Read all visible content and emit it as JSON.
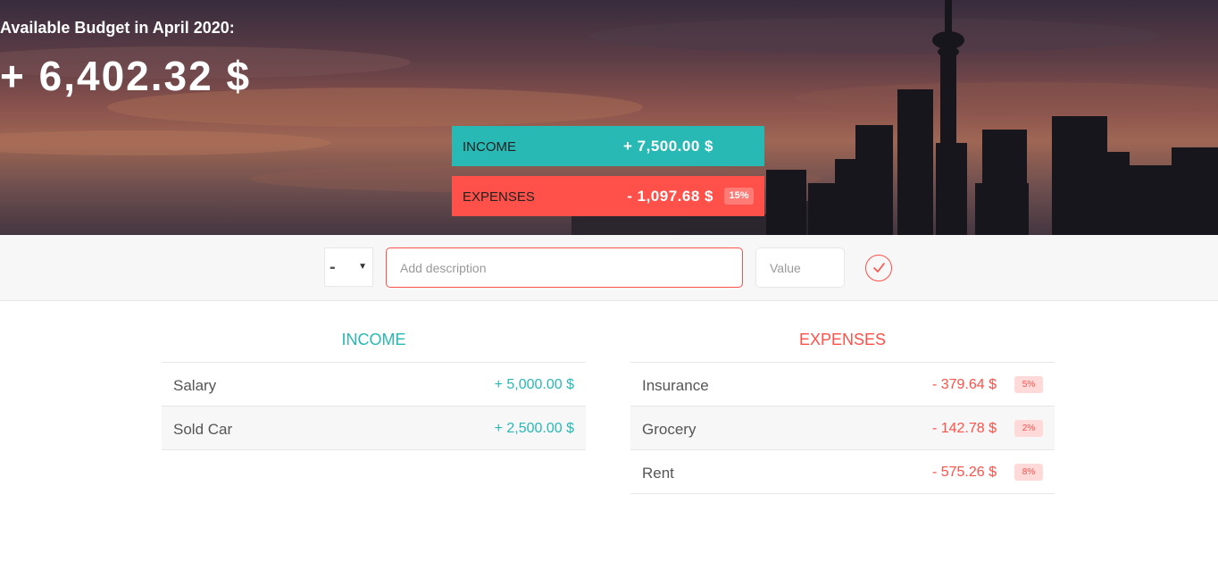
{
  "header": {
    "title": "Available Budget in April 2020:",
    "budget": "+ 6,402.32 $",
    "income": {
      "label": "INCOME",
      "value": "+ 7,500.00 $"
    },
    "expenses": {
      "label": "EXPENSES",
      "value": "- 1,097.68 $",
      "percentage": "15%"
    }
  },
  "add_form": {
    "type_value": "-",
    "description_placeholder": "Add description",
    "value_placeholder": "Value",
    "submit_icon": "checkmark-circle-icon"
  },
  "income": {
    "title": "INCOME",
    "items": [
      {
        "description": "Salary",
        "value": "+ 5,000.00 $"
      },
      {
        "description": "Sold Car",
        "value": "+ 2,500.00 $"
      }
    ]
  },
  "expenses": {
    "title": "EXPENSES",
    "items": [
      {
        "description": "Insurance",
        "value": "- 379.64 $",
        "percentage": "5%"
      },
      {
        "description": "Grocery",
        "value": "- 142.78 $",
        "percentage": "2%"
      },
      {
        "description": "Rent",
        "value": "- 575.26 $",
        "percentage": "8%"
      }
    ]
  },
  "colors": {
    "income": "#28b9b5",
    "expenses": "#ff5049",
    "bar_background": "#f7f7f7"
  }
}
